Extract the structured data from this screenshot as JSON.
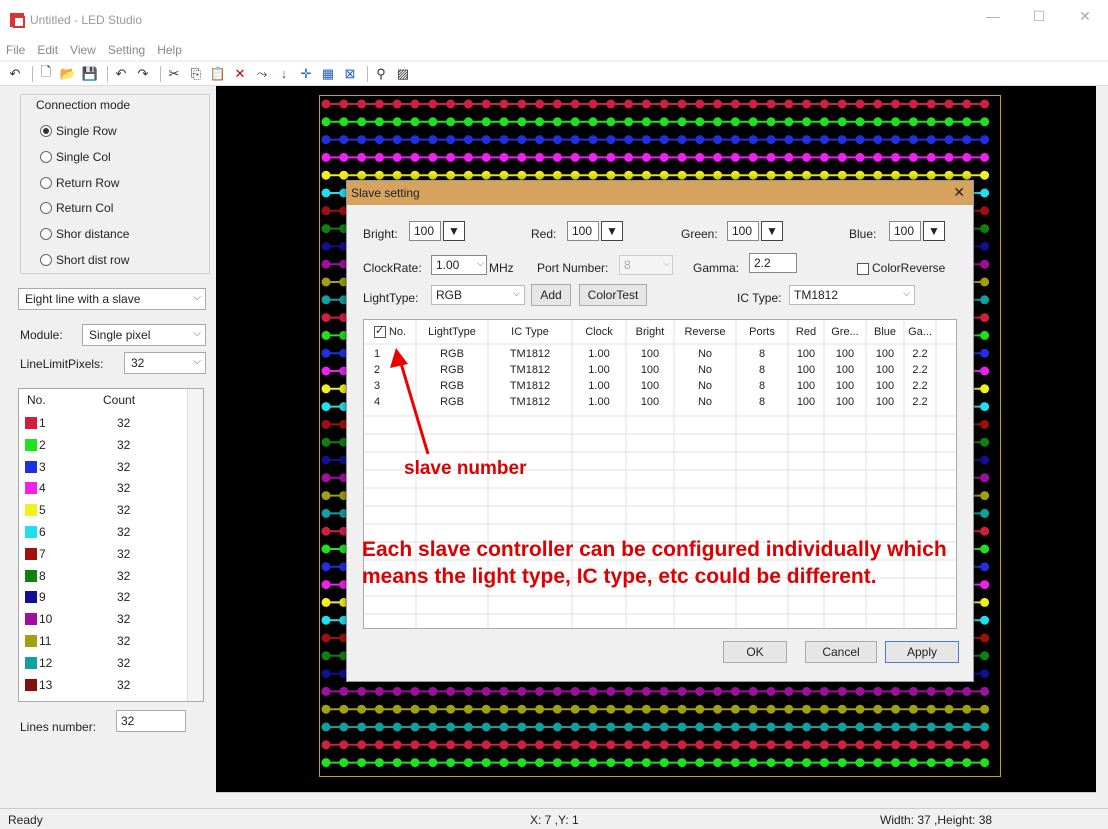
{
  "window": {
    "title": "Untitled - LED Studio"
  },
  "menu": [
    "File",
    "Edit",
    "View",
    "Setting",
    "Help"
  ],
  "toolbar_icons": [
    "undo-icon",
    "new-icon",
    "open-icon",
    "save-icon",
    "redo-icon",
    "redo2-icon",
    "cut-icon",
    "copy-icon",
    "paste-icon",
    "delete-icon",
    "route-icon",
    "down-icon",
    "cross-icon",
    "grid-icon",
    "frame-icon",
    "binocular-icon",
    "image-icon"
  ],
  "left": {
    "connection_mode": "Connection mode",
    "modes": [
      "Single Row",
      "Single Col",
      "Return Row",
      "Return Col",
      "Shor distance",
      "Short dist row"
    ],
    "selected_mode": 0,
    "line_mode": "Eight line with a slave",
    "module_label": "Module:",
    "module_value": "Single pixel",
    "limit_label": "LineLimitPixels:",
    "limit_value": "32",
    "list_header_no": "No.",
    "list_header_count": "Count",
    "list": [
      {
        "no": "1",
        "count": "32",
        "color": "#d02040"
      },
      {
        "no": "2",
        "count": "32",
        "color": "#20e020"
      },
      {
        "no": "3",
        "count": "32",
        "color": "#2030e0"
      },
      {
        "no": "4",
        "count": "32",
        "color": "#f020f0"
      },
      {
        "no": "5",
        "count": "32",
        "color": "#f0f020"
      },
      {
        "no": "6",
        "count": "32",
        "color": "#20e0f0"
      },
      {
        "no": "7",
        "count": "32",
        "color": "#a01010"
      },
      {
        "no": "8",
        "count": "32",
        "color": "#108010"
      },
      {
        "no": "9",
        "count": "32",
        "color": "#101090"
      },
      {
        "no": "10",
        "count": "32",
        "color": "#a010a0"
      },
      {
        "no": "11",
        "count": "32",
        "color": "#a0a010"
      },
      {
        "no": "12",
        "count": "32",
        "color": "#10a0a0"
      },
      {
        "no": "13",
        "count": "32",
        "color": "#801010"
      }
    ],
    "lines_label": "Lines number:",
    "lines_value": "32"
  },
  "status": {
    "left": "Ready",
    "mid": "X: 7 ,Y: 1",
    "right": "Width: 37 ,Height: 38"
  },
  "dialog": {
    "title": "Slave setting",
    "bright_label": "Bright:",
    "bright": "100",
    "red_label": "Red:",
    "red": "100",
    "green_label": "Green:",
    "green": "100",
    "blue_label": "Blue:",
    "blue": "100",
    "clock_label": "ClockRate:",
    "clock": "1.00",
    "mhz": "MHz",
    "port_label": "Port Number:",
    "port": "8",
    "gamma_label": "Gamma:",
    "gamma": "2.2",
    "colorreverse": "ColorReverse",
    "lighttype_label": "LightType:",
    "lighttype": "RGB",
    "add": "Add",
    "colortest": "ColorTest",
    "ic_label": "IC Type:",
    "ic": "TM1812",
    "columns": [
      "No.",
      "LightType",
      "IC Type",
      "Clock",
      "Bright",
      "Reverse",
      "Ports",
      "Red",
      "Gre...",
      "Blue",
      "Ga..."
    ],
    "rows": [
      [
        "1",
        "RGB",
        "TM1812",
        "1.00",
        "100",
        "No",
        "8",
        "100",
        "100",
        "100",
        "2.2"
      ],
      [
        "2",
        "RGB",
        "TM1812",
        "1.00",
        "100",
        "No",
        "8",
        "100",
        "100",
        "100",
        "2.2"
      ],
      [
        "3",
        "RGB",
        "TM1812",
        "1.00",
        "100",
        "No",
        "8",
        "100",
        "100",
        "100",
        "2.2"
      ],
      [
        "4",
        "RGB",
        "TM1812",
        "1.00",
        "100",
        "No",
        "8",
        "100",
        "100",
        "100",
        "2.2"
      ]
    ],
    "ok": "OK",
    "cancel": "Cancel",
    "apply": "Apply"
  },
  "annotations": {
    "slave_number": "slave number",
    "note": "Each slave controller can be configured individually which means the light type, IC type, etc could be different."
  },
  "led_colors": [
    "#d02040",
    "#20e020",
    "#2030e0",
    "#f020f0",
    "#f0f020",
    "#20e0f0",
    "#a01010",
    "#108010",
    "#101090",
    "#a010a0",
    "#a0a010",
    "#10a0a0"
  ]
}
